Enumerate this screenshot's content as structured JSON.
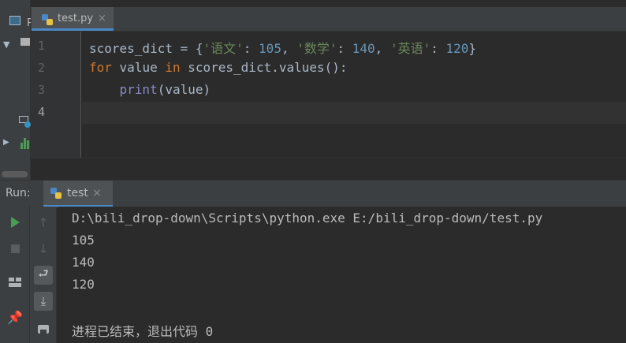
{
  "project_panel": {
    "tab_letter": "P"
  },
  "editor": {
    "tab_name": "test.py",
    "tab_close": "×",
    "line_numbers": [
      "1",
      "2",
      "3",
      "4"
    ],
    "lines": [
      [
        {
          "t": "scores_dict = {",
          "c": "plain"
        },
        {
          "t": "'语文'",
          "c": "str"
        },
        {
          "t": ": ",
          "c": "plain"
        },
        {
          "t": "105",
          "c": "num"
        },
        {
          "t": ", ",
          "c": "plain"
        },
        {
          "t": "'数学'",
          "c": "str"
        },
        {
          "t": ": ",
          "c": "plain"
        },
        {
          "t": "140",
          "c": "num"
        },
        {
          "t": ", ",
          "c": "plain"
        },
        {
          "t": "'英语'",
          "c": "str"
        },
        {
          "t": ": ",
          "c": "plain"
        },
        {
          "t": "120",
          "c": "num"
        },
        {
          "t": "}",
          "c": "plain"
        }
      ],
      [
        {
          "t": "for",
          "c": "kw"
        },
        {
          "t": " value ",
          "c": "plain"
        },
        {
          "t": "in",
          "c": "kw"
        },
        {
          "t": " scores_dict.values():",
          "c": "plain"
        }
      ],
      [
        {
          "t": "    ",
          "c": "plain"
        },
        {
          "t": "print",
          "c": "bi"
        },
        {
          "t": "(value)",
          "c": "plain"
        }
      ],
      []
    ]
  },
  "run_panel": {
    "label": "Run:",
    "tab_name": "test",
    "tab_close": "×",
    "output": [
      "D:\\bili_drop-down\\Scripts\\python.exe E:/bili_drop-down/test.py",
      "105",
      "140",
      "120",
      "",
      "进程已结束，退出代码 0"
    ]
  },
  "colors": {
    "keyword": "#cc7832",
    "string": "#6a8759",
    "number": "#6897bb",
    "builtin": "#8888c6",
    "accent": "#4a88c7",
    "run_green": "#499c54"
  },
  "icons": {
    "run_button": "play-icon",
    "stop_button": "stop-icon",
    "layout_button": "layout-icon",
    "pin_button": "pin-icon",
    "up_button": "arrow-up-icon",
    "down_button": "arrow-down-icon",
    "wrap_button": "soft-wrap-icon",
    "scroll_end_button": "scroll-to-end-icon",
    "print_button": "print-icon"
  }
}
